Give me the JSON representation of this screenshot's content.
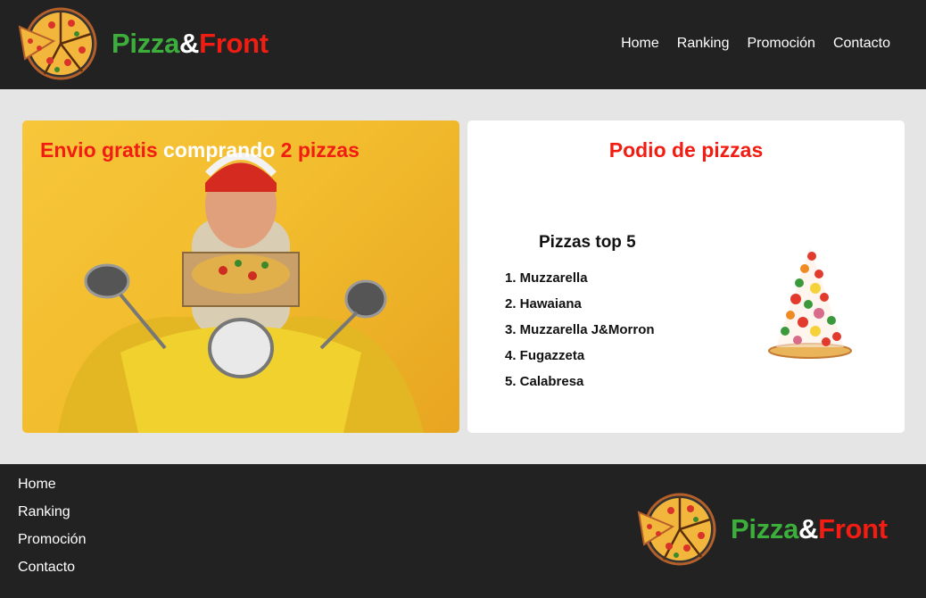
{
  "brand": {
    "part1": "Pizza",
    "part2": "&",
    "part3": "Front",
    "logo_icon": "pizza-slices-icon"
  },
  "nav": {
    "items": [
      "Home",
      "Ranking",
      "Promoción",
      "Contacto"
    ]
  },
  "promo": {
    "text1": "Envio gratis",
    "text2": "comprando",
    "text3": "2 pizzas",
    "image": "delivery-scooter-man-photo"
  },
  "podio": {
    "title": "Podio de pizzas",
    "list_title": "Pizzas top 5",
    "items": [
      "1. Muzzarella",
      "2. Hawaiana",
      "3. Muzzarella J&Morron",
      "4. Fugazzeta",
      "5. Calabresa"
    ],
    "image": "pizza-ingredients-tower-image"
  },
  "footer": {
    "links": [
      "Home",
      "Ranking",
      "Promoción",
      "Contacto"
    ]
  },
  "colors": {
    "dark": "#222222",
    "background": "#e5e5e5",
    "green": "#3cae3c",
    "red": "#f21d12",
    "white": "#ffffff",
    "promo_yellow": "#f2bd2e"
  }
}
